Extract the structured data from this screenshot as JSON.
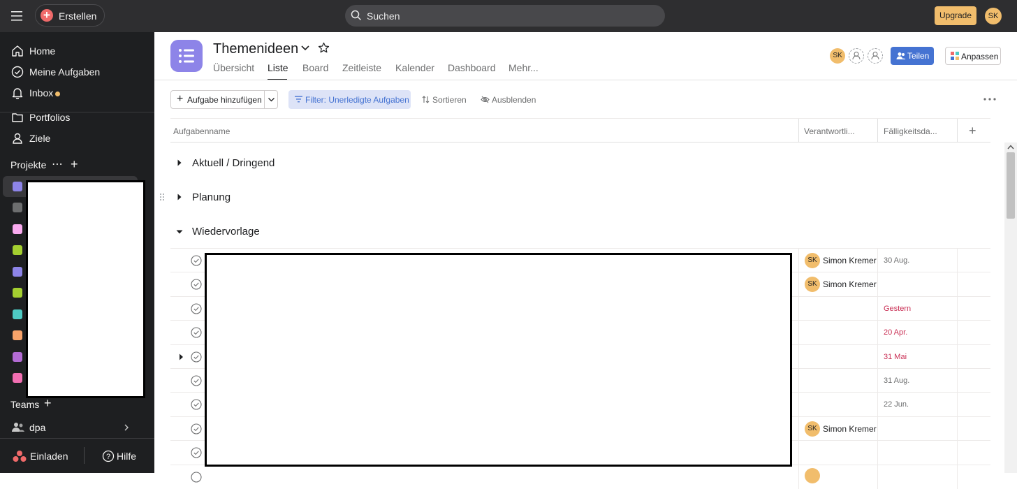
{
  "topbar": {
    "create_label": "Erstellen",
    "search_placeholder": "Suchen",
    "upgrade_label": "Upgrade",
    "user_initials": "SK"
  },
  "sidebar": {
    "nav": [
      {
        "label": "Home",
        "icon": "home-icon"
      },
      {
        "label": "Meine Aufgaben",
        "icon": "check-circle-icon"
      },
      {
        "label": "Inbox",
        "icon": "bell-icon"
      },
      {
        "label": "Portfolios",
        "icon": "folder-icon"
      },
      {
        "label": "Ziele",
        "icon": "person-icon"
      }
    ],
    "projects_label": "Projekte",
    "project_colors": [
      "#8d84e8",
      "#6d6e6f",
      "#f9aaef",
      "#a4cf30",
      "#8d84e8",
      "#a4cf30",
      "#4ecbc4",
      "#f8a36a",
      "#b36bd4",
      "#f26fb2"
    ],
    "teams_label": "Teams",
    "team_name": "dpa",
    "invite_label": "Einladen",
    "help_label": "Hilfe"
  },
  "project": {
    "title": "Themenideen",
    "icon_color": "#8d84e8",
    "tabs": [
      "Übersicht",
      "Liste",
      "Board",
      "Zeitleiste",
      "Kalender",
      "Dashboard",
      "Mehr..."
    ],
    "active_tab": "Liste",
    "member_initials": "SK",
    "share_label": "Teilen",
    "customize_label": "Anpassen"
  },
  "toolbar": {
    "add_task_label": "Aufgabe hinzufügen",
    "filter_label": "Filter: Unerledigte Aufgaben",
    "sort_label": "Sortieren",
    "hide_label": "Ausblenden"
  },
  "table": {
    "headers": {
      "name": "Aufgabenname",
      "assignee": "Verantwortli...",
      "due": "Fälligkeitsda..."
    },
    "sections": [
      {
        "name": "Aktuell / Dringend",
        "expanded": false
      },
      {
        "name": "Planung",
        "expanded": false
      },
      {
        "name": "Wiedervorlage",
        "expanded": true
      }
    ],
    "rows": [
      {
        "assignee_initials": "SK",
        "assignee": "Simon Kremer",
        "due": "30 Aug.",
        "overdue": false
      },
      {
        "assignee_initials": "SK",
        "assignee": "Simon Kremer",
        "due": "",
        "overdue": false
      },
      {
        "assignee_initials": "",
        "assignee": "",
        "due": "Gestern",
        "overdue": true
      },
      {
        "assignee_initials": "",
        "assignee": "",
        "due": "20 Apr.",
        "overdue": true
      },
      {
        "assignee_initials": "",
        "assignee": "",
        "due": "31 Mai",
        "overdue": true,
        "has_subtasks": true
      },
      {
        "assignee_initials": "",
        "assignee": "",
        "due": "31 Aug.",
        "overdue": false
      },
      {
        "assignee_initials": "",
        "assignee": "",
        "due": "22 Jun.",
        "overdue": false
      },
      {
        "assignee_initials": "SK",
        "assignee": "Simon Kremer",
        "due": "",
        "overdue": false
      },
      {
        "assignee_initials": "",
        "assignee": "",
        "due": "",
        "overdue": false
      }
    ]
  },
  "colors": {
    "topbar_bg": "#2e2e30",
    "sidebar_bg": "#1e1f21",
    "accent_blue": "#4573d2",
    "overdue_red": "#c92f54",
    "avatar_yellow": "#f1bd6c"
  }
}
